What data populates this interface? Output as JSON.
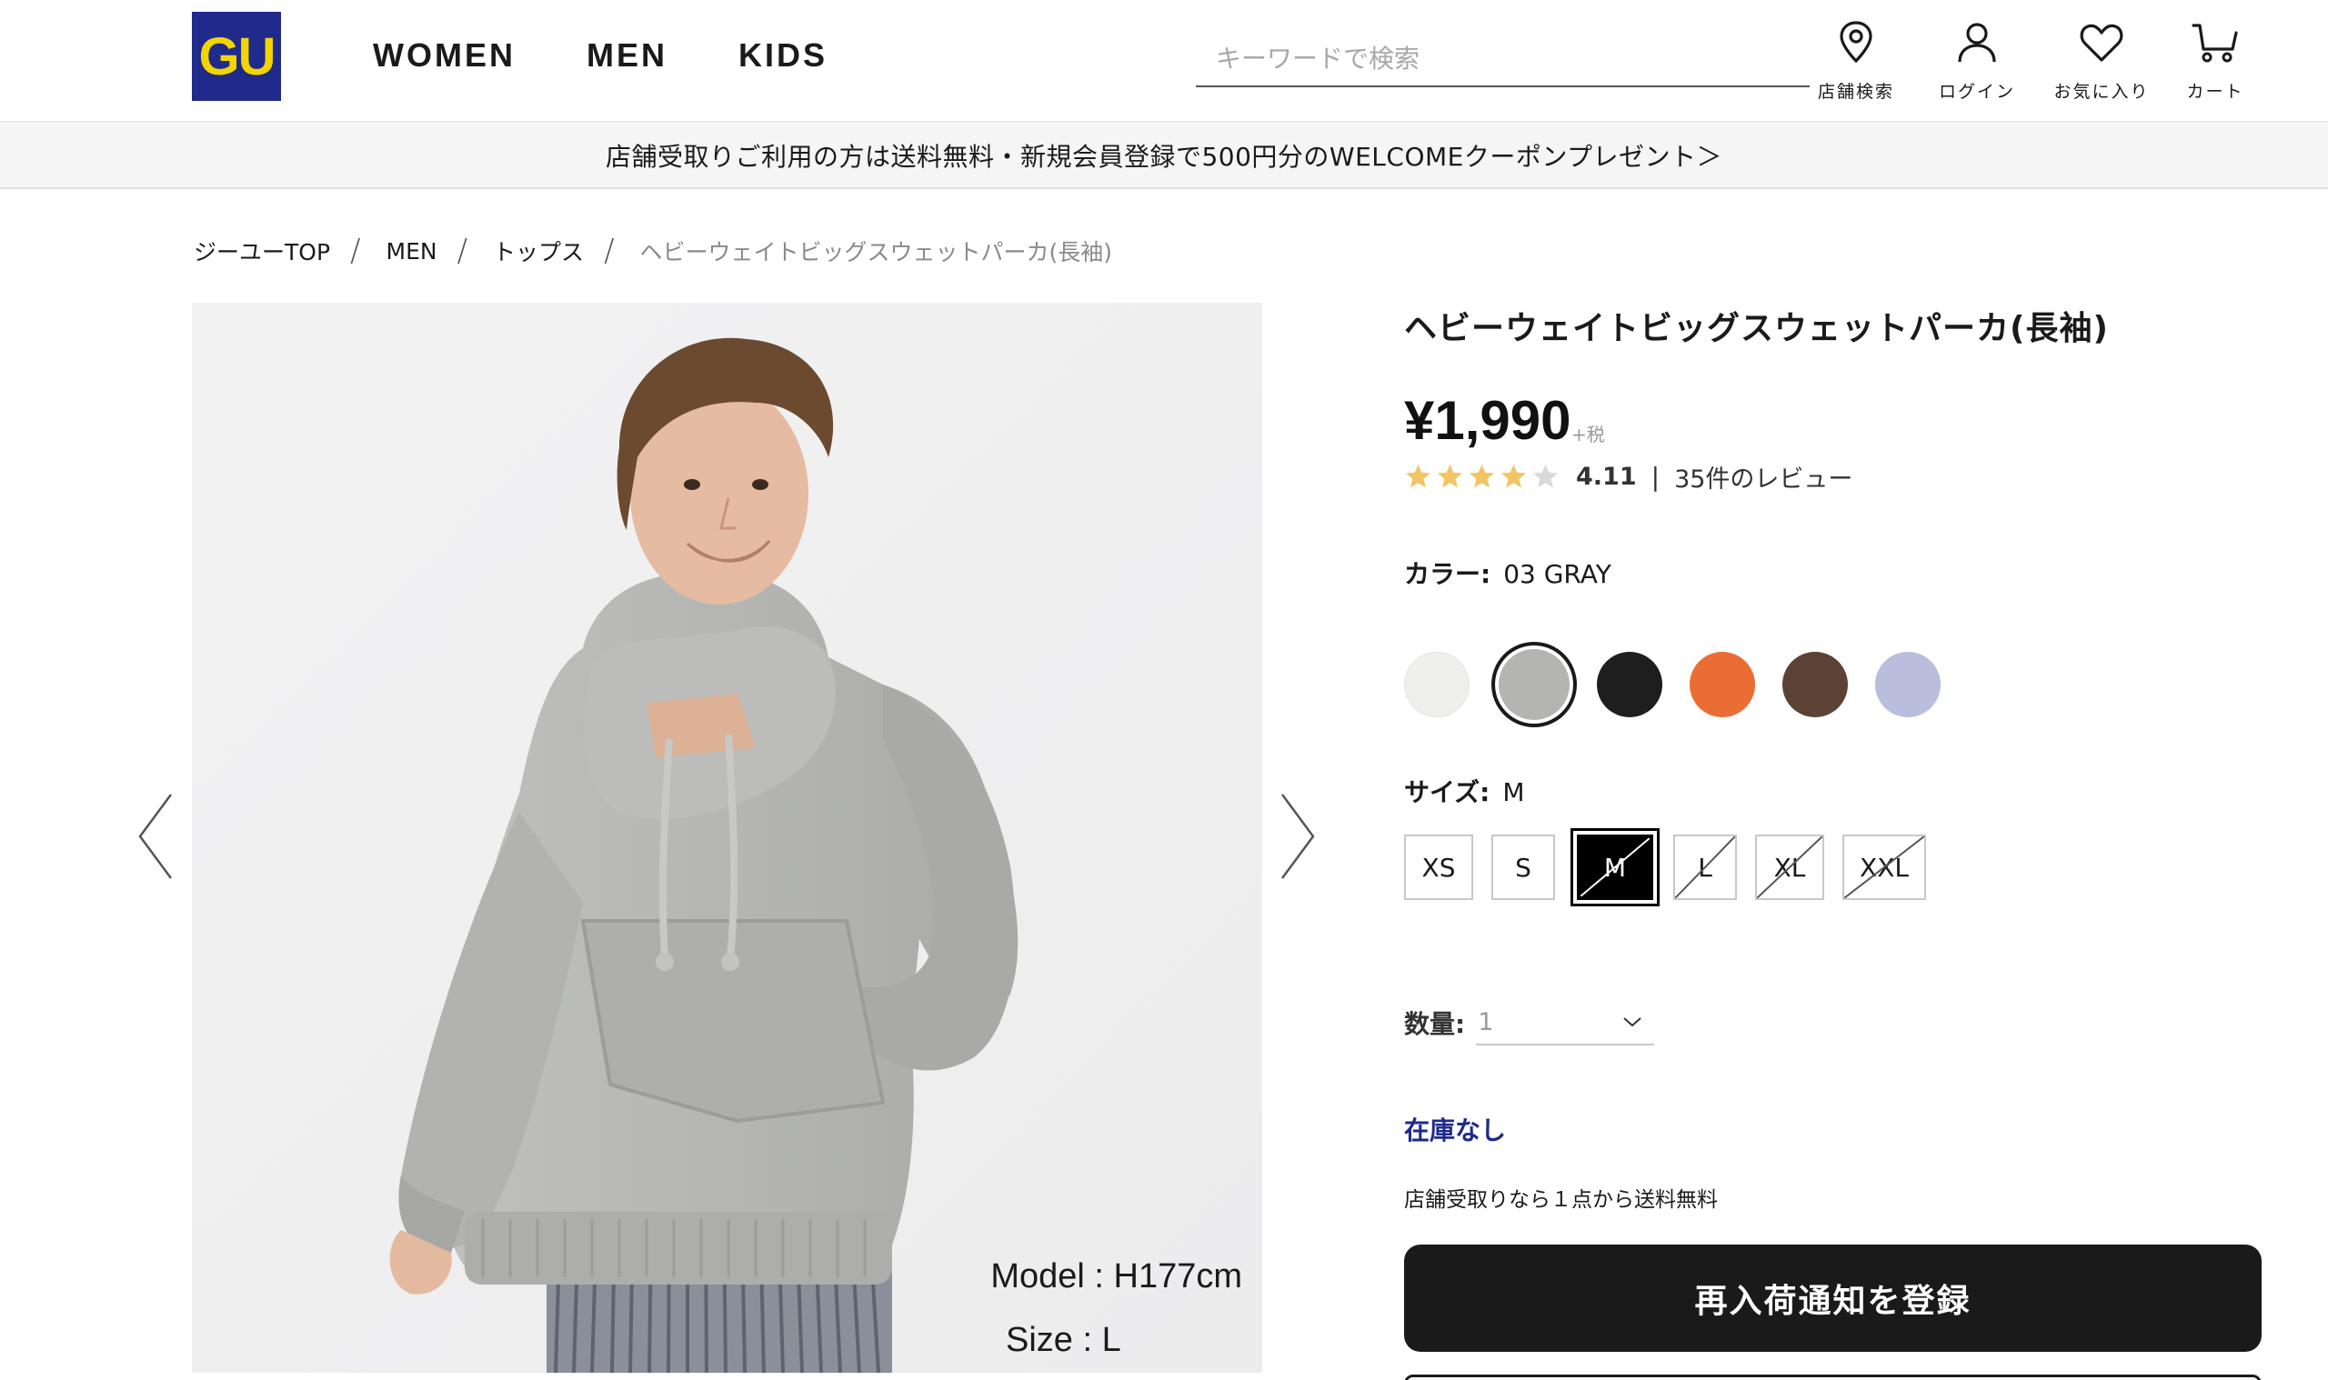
{
  "header": {
    "logo_text": "GU",
    "nav": [
      "WOMEN",
      "MEN",
      "KIDS"
    ],
    "search_placeholder": "キーワードで検索",
    "icons": {
      "store": "店舗検索",
      "login": "ログイン",
      "favorites": "お気に入り",
      "cart": "カート"
    }
  },
  "banner": {
    "text": "店舗受取りご利用の方は送料無料・新規会員登録で500円分のWELCOMEクーポンプレゼント＞"
  },
  "breadcrumb": [
    "ジーユーTOP",
    "MEN",
    "トップス",
    "ヘビーウェイトビッグスウェットパーカ(長袖)"
  ],
  "gallery": {
    "model_height": "Model : H177cm",
    "model_size": "Size : L"
  },
  "product": {
    "title": "ヘビーウェイトビッグスウェットパーカ(長袖)",
    "price": "¥1,990",
    "tax_note": "+税",
    "rating_value": "4.11",
    "rating_stars": 4,
    "rating_max": 5,
    "review_link": "35件のレビュー",
    "color_label": "カラー:",
    "color_value": "03 GRAY",
    "colors": [
      {
        "name": "off-white",
        "hex": "#efefed",
        "selected": false
      },
      {
        "name": "gray",
        "hex": "#b4b5b3",
        "selected": true
      },
      {
        "name": "black",
        "hex": "#1e1e1e",
        "selected": false
      },
      {
        "name": "orange",
        "hex": "#ea6e34",
        "selected": false
      },
      {
        "name": "brown",
        "hex": "#5b4234",
        "selected": false
      },
      {
        "name": "light-blue",
        "hex": "#b8bedc",
        "selected": false
      }
    ],
    "size_label": "サイズ:",
    "size_value": "M",
    "sizes": [
      {
        "label": "XS",
        "state": "available"
      },
      {
        "label": "S",
        "state": "available"
      },
      {
        "label": "M",
        "state": "selected-unavailable"
      },
      {
        "label": "L",
        "state": "unavailable"
      },
      {
        "label": "XL",
        "state": "unavailable"
      },
      {
        "label": "XXL",
        "state": "unavailable"
      }
    ],
    "quantity_label": "数量:",
    "quantity_value": "1",
    "stock_status": "在庫なし",
    "pickup_note": "店舗受取りなら１点から送料無料",
    "restock_button": "再入荷通知を登録"
  },
  "colors": {
    "brand_navy": "#1f2a8a",
    "brand_yellow": "#f2d500",
    "star_gold": "#f1c564",
    "star_gray": "#d9d9d9"
  }
}
